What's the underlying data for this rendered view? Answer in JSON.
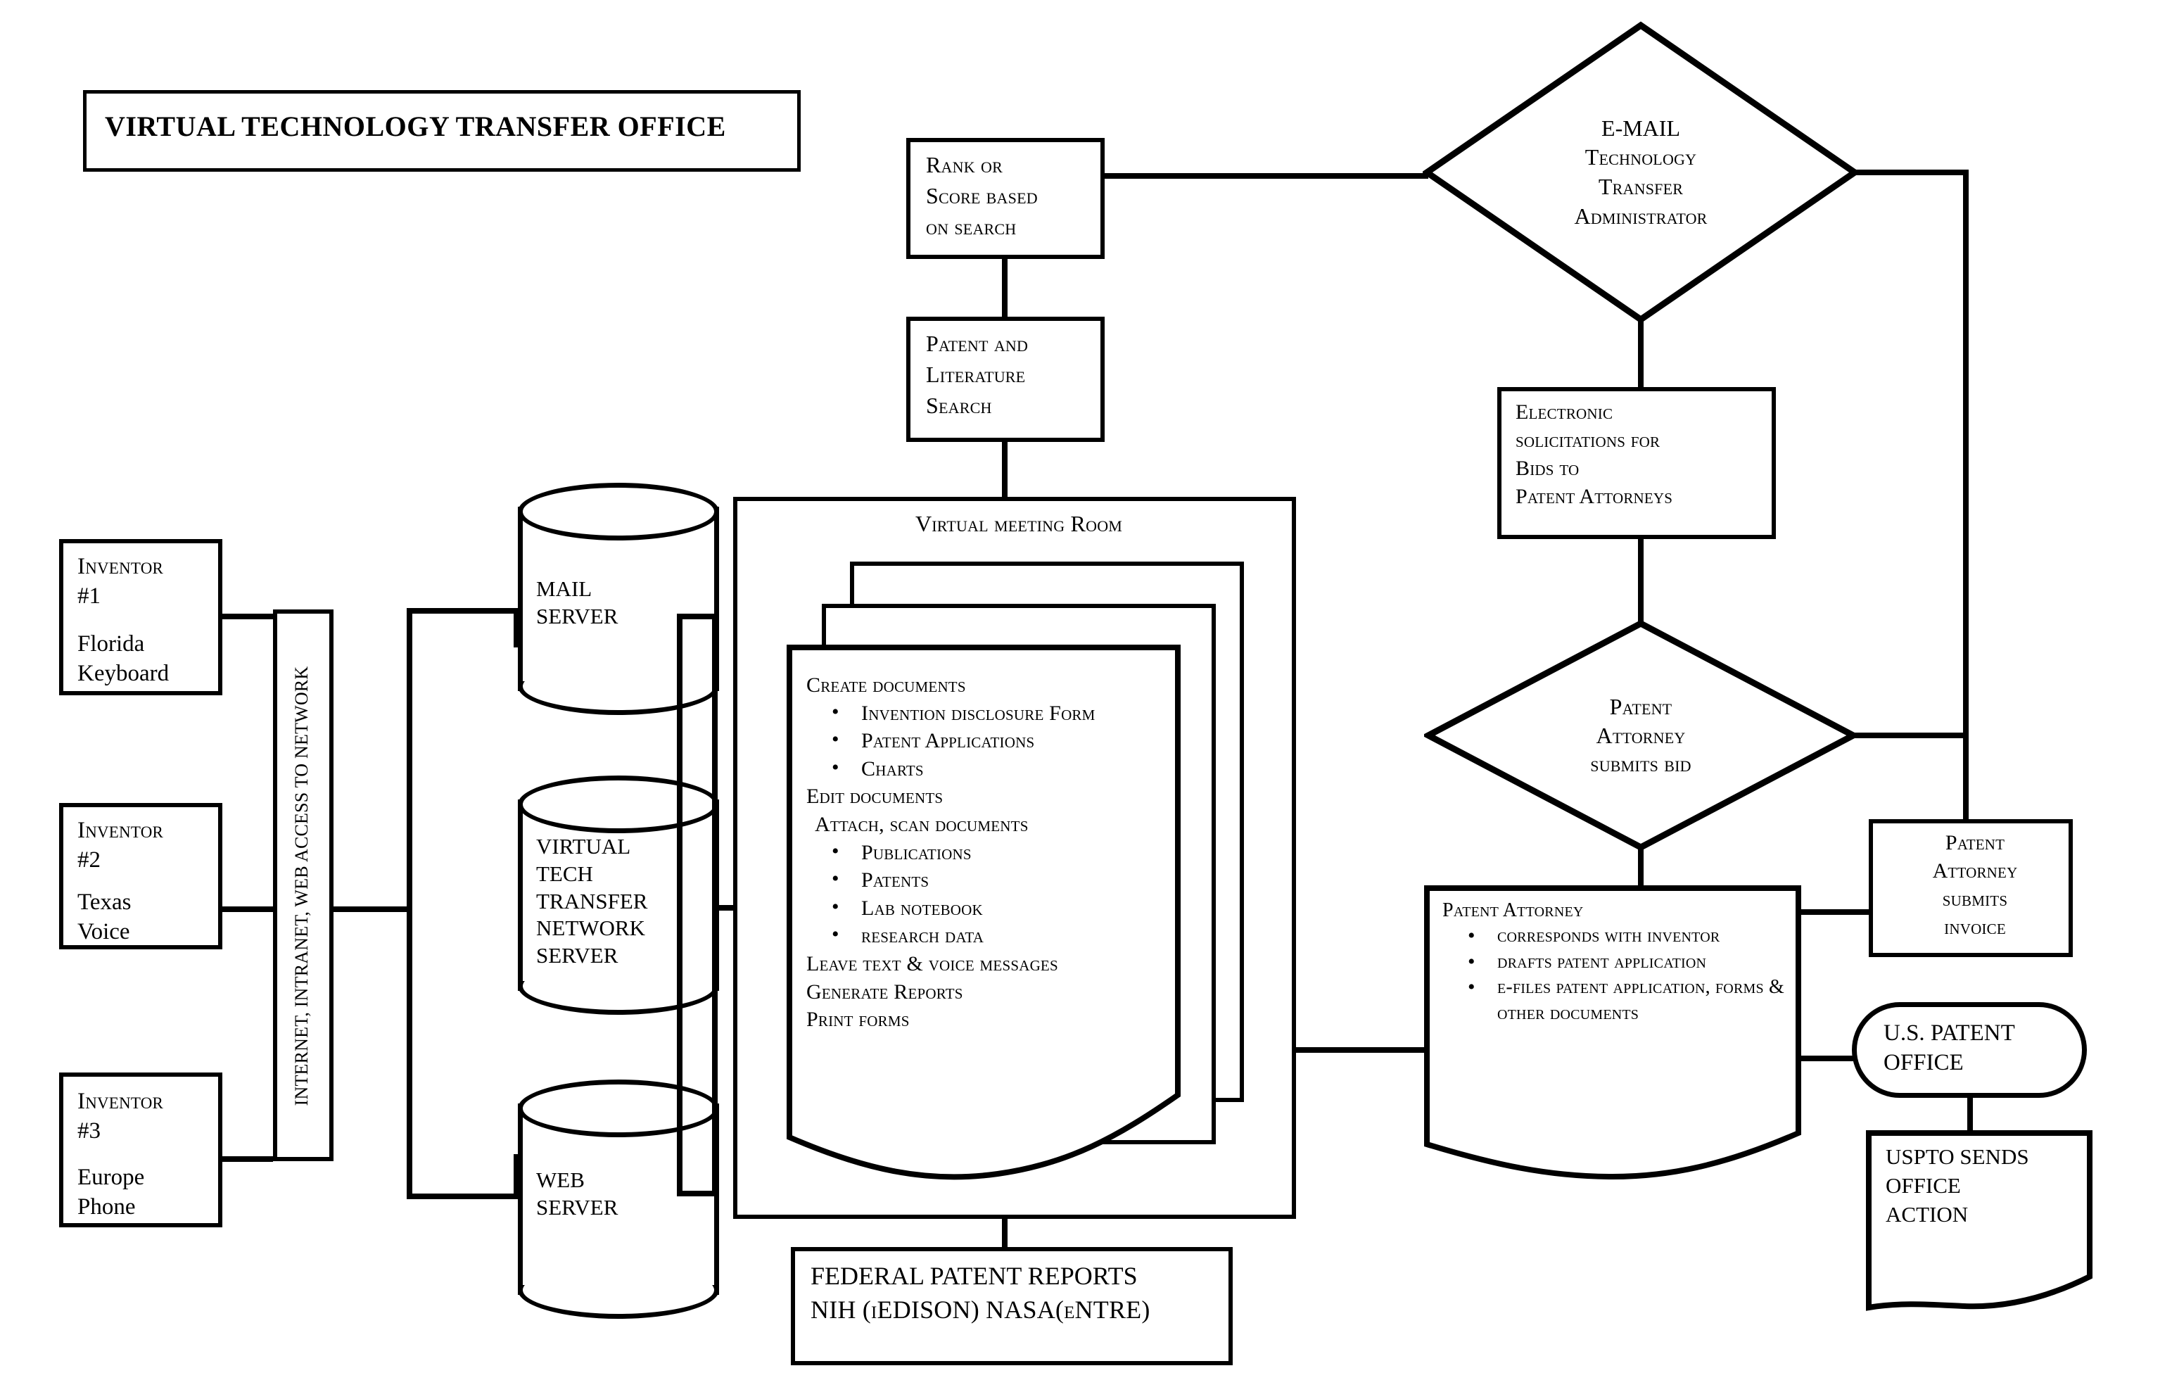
{
  "diagram": {
    "title": "VIRTUAL TECHNOLOGY TRANSFER OFFICE",
    "inventors": [
      {
        "name": "Inventor",
        "number": "#1",
        "location": "Florida",
        "device": "Keyboard"
      },
      {
        "name": "Inventor",
        "number": "#2",
        "location": "Texas",
        "device": "Voice"
      },
      {
        "name": "Inventor",
        "number": "#3",
        "location": "Europe",
        "device": "Phone"
      }
    ],
    "network_bar": {
      "label": "INTERNET, INTRANET, WEB ACCESS TO NETWORK"
    },
    "servers": [
      {
        "line1": "MAIL",
        "line2": "SERVER"
      },
      {
        "line1": "VIRTUAL",
        "line2": "TECH",
        "line3": "TRANSFER",
        "line4": "NETWORK",
        "line5": "SERVER"
      },
      {
        "line1": "WEB",
        "line2": "SERVER"
      }
    ],
    "rank_box": {
      "line1": "Rank or",
      "line2": "Score based",
      "line3": "on search"
    },
    "search_box": {
      "line1": "Patent and",
      "line2": "Literature",
      "line3": "Search"
    },
    "meeting_room": {
      "label": "Virtual meeting Room"
    },
    "meeting_doc": {
      "heading1": "Create documents",
      "group1": [
        "Invention  disclosure Form",
        "Patent Applications",
        "Charts"
      ],
      "heading2": "Edit documents",
      "heading3": "Attach, scan documents",
      "group2": [
        "Publications",
        "Patents",
        "Lab notebook",
        "research data"
      ],
      "footer1": "Leave text & voice messages",
      "footer2": "Generate Reports",
      "footer3": "Print forms"
    },
    "federal_reports": {
      "line1": "FEDERAL PATENT REPORTS",
      "line2": "NIH (iEDISON) NASA(eNTRE)"
    },
    "email_admin": {
      "line1": "E-MAIL",
      "line2": "Technology",
      "line3": "Transfer",
      "line4": "Administrator"
    },
    "solicitations": {
      "line1": "Electronic",
      "line2": "solicitations for",
      "line3": "Bids to",
      "line4": "Patent Attorneys"
    },
    "bid_diamond": {
      "line1": "Patent",
      "line2": "Attorney",
      "line3": "submits bid"
    },
    "patent_attorney_doc": {
      "heading": "Patent Attorney",
      "items": [
        "corresponds with inventor",
        "drafts patent application",
        "e-files patent application, forms & other documents"
      ]
    },
    "invoice_box": {
      "line1": "Patent",
      "line2": "Attorney",
      "line3": "submits",
      "line4": "invoice"
    },
    "uspto_office": {
      "line1": "U.S. PATENT",
      "line2": "OFFICE"
    },
    "uspto_action": {
      "line1": "USPTO SENDS",
      "line2": "OFFICE",
      "line3": "ACTION"
    }
  }
}
